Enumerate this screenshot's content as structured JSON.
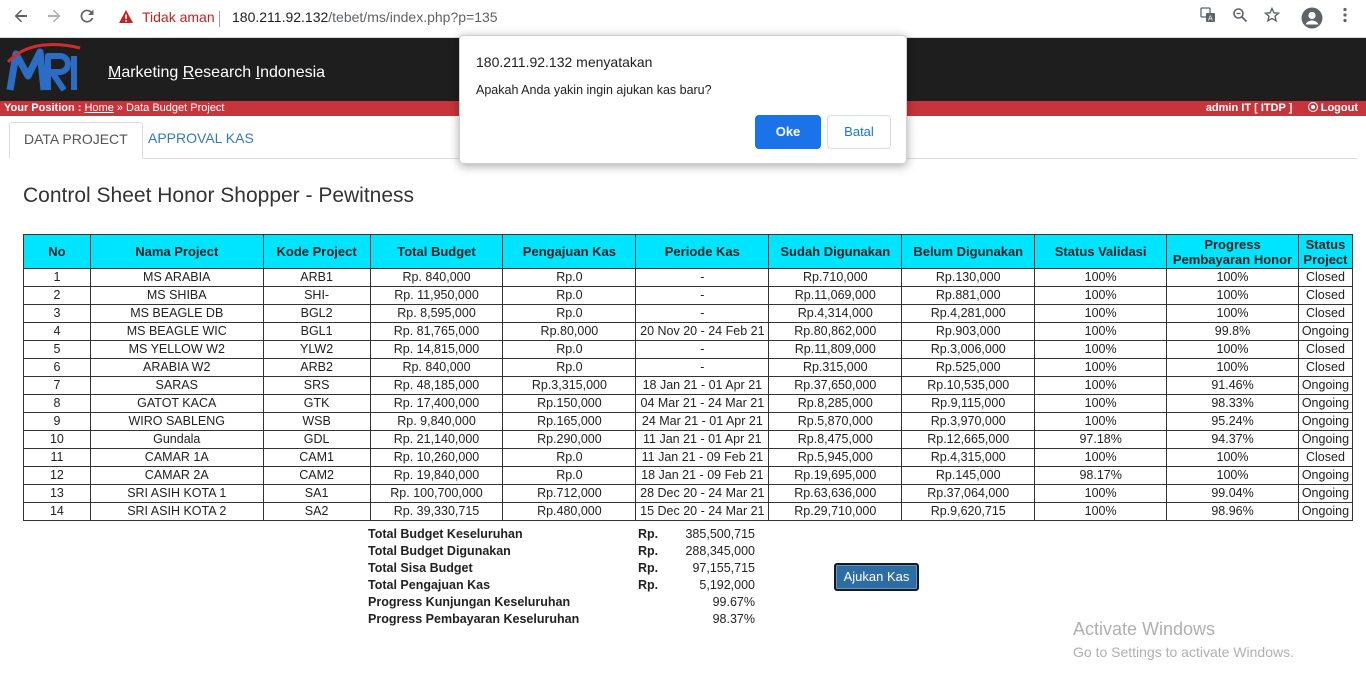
{
  "browser": {
    "security_label": "Tidak aman",
    "url_host": "180.211.92.132",
    "url_path": "/tebet/ms/index.php?p=135"
  },
  "header": {
    "logo_text": "MRI",
    "site_title_parts": [
      "M",
      "arketing ",
      "R",
      "esearch ",
      "I",
      "ndonesia"
    ]
  },
  "position_bar": {
    "label": "Your Position :",
    "home_link": "Home",
    "crumb": " » Data Budget Project",
    "user": "admin IT [ ITDP ]",
    "logout": "Logout"
  },
  "tabs": [
    {
      "label": "DATA PROJECT"
    },
    {
      "label": "APPROVAL KAS"
    }
  ],
  "page_title": "Control Sheet Honor Shopper - Pewitness",
  "table": {
    "headers": [
      "No",
      "Nama Project",
      "Kode Project",
      "Total Budget",
      "Pengajuan Kas",
      "Periode Kas",
      "Sudah Digunakan",
      "Belum Digunakan",
      "Status Validasi",
      "Progress Pembayaran Honor",
      "Status Project"
    ],
    "rows": [
      [
        "1",
        "MS ARABIA",
        "ARB1",
        "Rp. 840,000",
        "Rp.0",
        "-",
        "Rp.710,000",
        "Rp.130,000",
        "100%",
        "100%",
        "Closed"
      ],
      [
        "2",
        "MS SHIBA",
        "SHI-",
        "Rp. 11,950,000",
        "Rp.0",
        "-",
        "Rp.11,069,000",
        "Rp.881,000",
        "100%",
        "100%",
        "Closed"
      ],
      [
        "3",
        "MS BEAGLE DB",
        "BGL2",
        "Rp. 8,595,000",
        "Rp.0",
        "-",
        "Rp.4,314,000",
        "Rp.4,281,000",
        "100%",
        "100%",
        "Closed"
      ],
      [
        "4",
        "MS BEAGLE WIC",
        "BGL1",
        "Rp. 81,765,000",
        "Rp.80,000",
        "20 Nov 20 - 24 Feb 21",
        "Rp.80,862,000",
        "Rp.903,000",
        "100%",
        "99.8%",
        "Ongoing"
      ],
      [
        "5",
        "MS YELLOW W2",
        "YLW2",
        "Rp. 14,815,000",
        "Rp.0",
        "-",
        "Rp.11,809,000",
        "Rp.3,006,000",
        "100%",
        "100%",
        "Closed"
      ],
      [
        "6",
        "ARABIA W2",
        "ARB2",
        "Rp. 840,000",
        "Rp.0",
        "-",
        "Rp.315,000",
        "Rp.525,000",
        "100%",
        "100%",
        "Closed"
      ],
      [
        "7",
        "SARAS",
        "SRS",
        "Rp. 48,185,000",
        "Rp.3,315,000",
        "18 Jan 21 - 01 Apr 21",
        "Rp.37,650,000",
        "Rp.10,535,000",
        "100%",
        "91.46%",
        "Ongoing"
      ],
      [
        "8",
        "GATOT KACA",
        "GTK",
        "Rp. 17,400,000",
        "Rp.150,000",
        "04 Mar 21 - 24 Mar 21",
        "Rp.8,285,000",
        "Rp.9,115,000",
        "100%",
        "98.33%",
        "Ongoing"
      ],
      [
        "9",
        "WIRO SABLENG",
        "WSB",
        "Rp. 9,840,000",
        "Rp.165,000",
        "24 Mar 21 - 01 Apr 21",
        "Rp.5,870,000",
        "Rp.3,970,000",
        "100%",
        "95.24%",
        "Ongoing"
      ],
      [
        "10",
        "Gundala",
        "GDL",
        "Rp. 21,140,000",
        "Rp.290,000",
        "11 Jan 21 - 01 Apr 21",
        "Rp.8,475,000",
        "Rp.12,665,000",
        "97.18%",
        "94.37%",
        "Ongoing"
      ],
      [
        "11",
        "CAMAR 1A",
        "CAM1",
        "Rp. 10,260,000",
        "Rp.0",
        "11 Jan 21 - 09 Feb 21",
        "Rp.5,945,000",
        "Rp.4,315,000",
        "100%",
        "100%",
        "Closed"
      ],
      [
        "12",
        "CAMAR 2A",
        "CAM2",
        "Rp. 19,840,000",
        "Rp.0",
        "18 Jan 21 - 09 Feb 21",
        "Rp.19,695,000",
        "Rp.145,000",
        "98.17%",
        "100%",
        "Ongoing"
      ],
      [
        "13",
        "SRI ASIH KOTA 1",
        "SA1",
        "Rp. 100,700,000",
        "Rp.712,000",
        "28 Dec 20 - 24 Mar 21",
        "Rp.63,636,000",
        "Rp.37,064,000",
        "100%",
        "99.04%",
        "Ongoing"
      ],
      [
        "14",
        "SRI ASIH KOTA 2",
        "SA2",
        "Rp. 39,330,715",
        "Rp.480,000",
        "15 Dec 20 - 24 Mar 21",
        "Rp.29,710,000",
        "Rp.9,620,715",
        "100%",
        "98.96%",
        "Ongoing"
      ]
    ]
  },
  "summary": [
    {
      "label": "Total Budget Keseluruhan",
      "currency": "Rp.",
      "value": "385,500,715"
    },
    {
      "label": "Total Budget Digunakan",
      "currency": "Rp.",
      "value": "288,345,000"
    },
    {
      "label": "Total Sisa Budget",
      "currency": "Rp.",
      "value": "97,155,715"
    },
    {
      "label": "Total Pengajuan Kas",
      "currency": "Rp.",
      "value": "5,192,000"
    },
    {
      "label": "Progress Kunjungan Keseluruhan",
      "currency": "",
      "value": "99.67%"
    },
    {
      "label": "Progress Pembayaran Keseluruhan",
      "currency": "",
      "value": "98.37%"
    }
  ],
  "ajukan_button": "Ajukan Kas",
  "watermark": {
    "line1": "Activate Windows",
    "line2": "Go to Settings to activate Windows."
  },
  "dialog": {
    "title": "180.211.92.132 menyatakan",
    "message": "Apakah Anda yakin ingin ajukan kas baru?",
    "ok": "Oke",
    "cancel": "Batal"
  },
  "colors": {
    "header_bg": "#1e1e1e",
    "position_bar": "#c8343b",
    "table_header": "#00e5ff",
    "dialog_primary": "#1a73e8",
    "ajukan_button": "#2e6da4"
  }
}
